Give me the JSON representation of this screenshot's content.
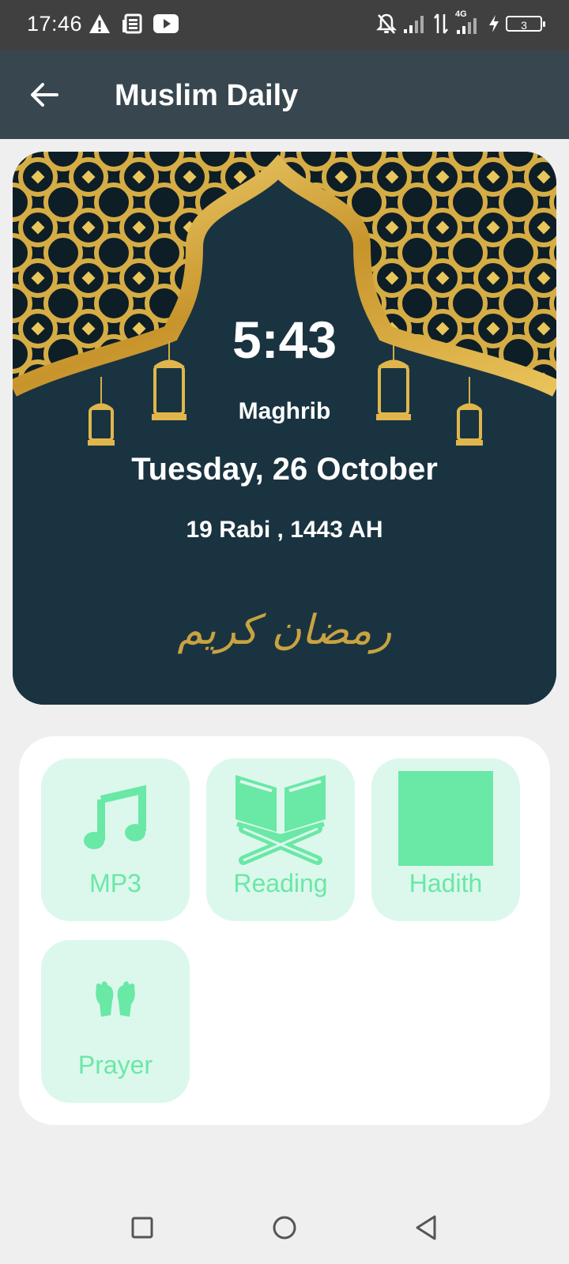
{
  "status_bar": {
    "time": "17:46",
    "battery": "3",
    "network": "4G",
    "icons": [
      "warning-icon",
      "news-icon",
      "youtube-icon",
      "notifications-off-icon",
      "signal-icon",
      "data-arrows-icon",
      "charging-icon"
    ]
  },
  "app_bar": {
    "title": "Muslim Daily",
    "back_icon": "arrow-left-icon"
  },
  "hero": {
    "time": "5:43",
    "prayer": "Maghrib",
    "date": "Tuesday, 26 October",
    "hijri": "19 Rabi , 1443 AH",
    "calligraphy": "رمضان كريم",
    "colors": {
      "gold": "#d4a93a",
      "background": "#1a3340"
    }
  },
  "menu": {
    "tiles": [
      {
        "label": "MP3",
        "icon": "music-note-icon"
      },
      {
        "label": "Reading",
        "icon": "quran-icon"
      },
      {
        "label": "Hadith",
        "icon": "hadith-icon"
      },
      {
        "label": "Prayer",
        "icon": "praying-hands-icon"
      }
    ],
    "colors": {
      "tile_bg": "#dcf8ec",
      "accent": "#69e8a6"
    }
  },
  "nav_bar": {
    "icons": [
      "recents-square-icon",
      "home-circle-icon",
      "back-triangle-icon"
    ]
  }
}
